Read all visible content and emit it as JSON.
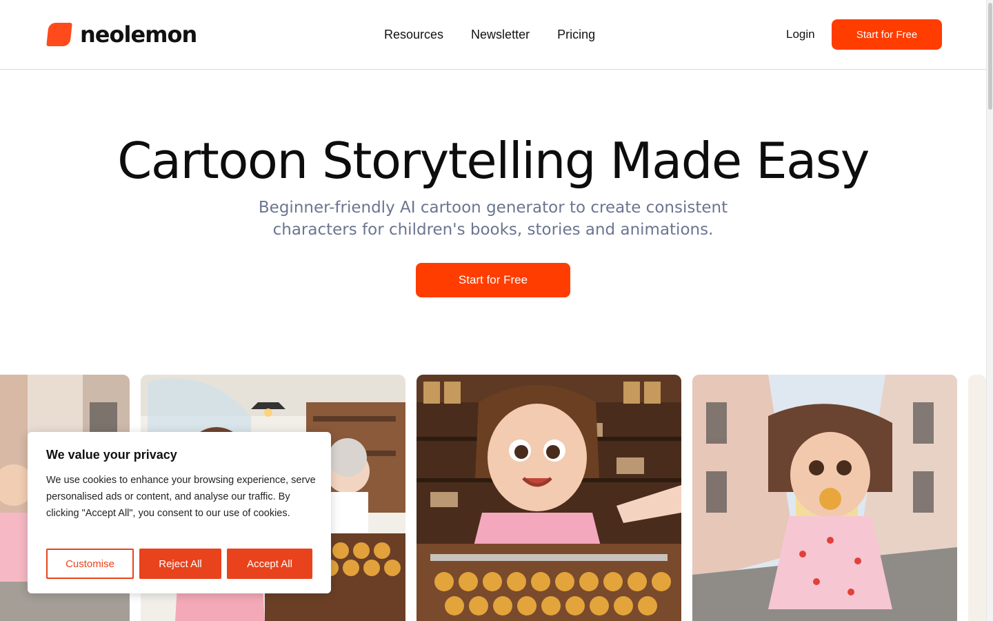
{
  "header": {
    "brand": "neolemon",
    "nav": [
      "Resources",
      "Newsletter",
      "Pricing"
    ],
    "login_label": "Login",
    "cta_label": "Start for Free"
  },
  "hero": {
    "title": "Cartoon Storytelling Made Easy",
    "subtitle_line1": "Beginner-friendly AI cartoon generator to create consistent",
    "subtitle_line2": "characters for children's books, stories and animations.",
    "cta_label": "Start for Free"
  },
  "gallery": {
    "images": [
      "girl-on-street-partial-image",
      "girl-at-bakery-counter-image",
      "girl-buying-pastry-image",
      "girl-eating-pastry-on-street-image",
      "partial-image"
    ]
  },
  "cookie_banner": {
    "title": "We value your privacy",
    "body": "We use cookies to enhance your browsing experience, serve personalised ads or content, and analyse our traffic. By clicking \"Accept All\", you consent to our use of cookies.",
    "customise_label": "Customise",
    "reject_label": "Reject All",
    "accept_label": "Accept All"
  },
  "colors": {
    "brand": "#ff3d00",
    "cookie_accent": "#e8431c",
    "subtitle": "#6b7590"
  }
}
